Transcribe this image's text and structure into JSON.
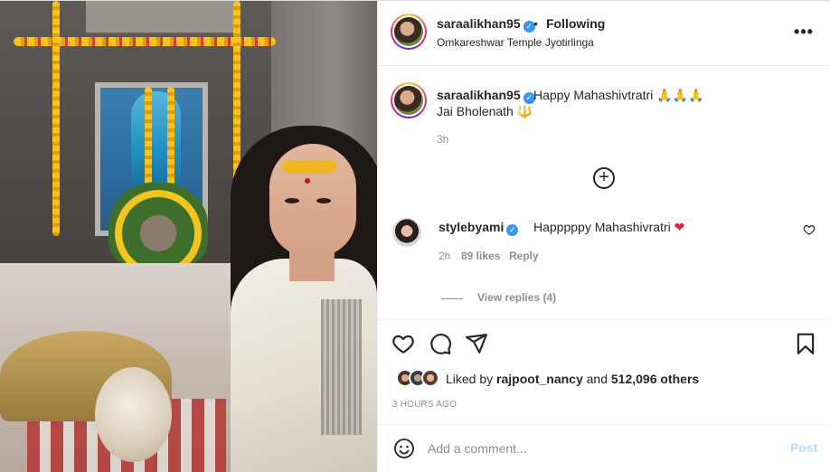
{
  "post": {
    "username": "saraalikhan95",
    "separator": "•",
    "follow_status": "Following",
    "location": "Omkareshwar Temple Jyotirlinga",
    "more_icon": "more-horizontal-icon",
    "verified_icon": "verified-badge-icon"
  },
  "caption": {
    "username": "saraalikhan95",
    "text": "Happy Mahashivtratri 🙏🙏🙏",
    "line2": "Jai Bholenath 🔱",
    "time": "3h"
  },
  "load_more_icon": "plus-circle-icon",
  "comment": {
    "username": "stylebyami",
    "text": "Happpppy Mahashivratri",
    "heart": "❤",
    "time": "2h",
    "likes": "89 likes",
    "reply": "Reply"
  },
  "view_replies": "View replies (4)",
  "actions": {
    "icons": [
      "heart-icon",
      "comment-icon",
      "share-icon",
      "bookmark-icon"
    ]
  },
  "likes": {
    "prefix": "Liked by ",
    "user": "rajpoot_nancy",
    "middle": " and ",
    "others": "512,096 others"
  },
  "timestamp": "3 HOURS AGO",
  "comment_bar": {
    "placeholder": "Add a comment...",
    "post_label": "Post"
  },
  "colors": {
    "link_blue": "#3897f0",
    "post_button_disabled": "#b3dbff",
    "secondary_text": "#8e8e8e",
    "heart_red": "#ed1b2e"
  }
}
